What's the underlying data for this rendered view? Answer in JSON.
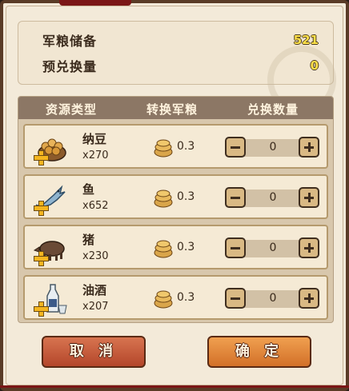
{
  "summary": {
    "grain_reserve_label": "军粮储备",
    "grain_reserve_value": "521",
    "expected_exchange_label": "预兑换量",
    "expected_exchange_value": "0"
  },
  "table": {
    "headers": [
      "资源类型",
      "转换军粮",
      "兑换数量"
    ],
    "rows": [
      {
        "name": "纳豆",
        "count": "x270",
        "rate": "0.3",
        "qty": "0",
        "icon": "natto-icon"
      },
      {
        "name": "鱼",
        "count": "x652",
        "rate": "0.3",
        "qty": "0",
        "icon": "fish-icon"
      },
      {
        "name": "猪",
        "count": "x230",
        "rate": "0.3",
        "qty": "0",
        "icon": "boar-icon"
      },
      {
        "name": "油酒",
        "count": "x207",
        "rate": "0.3",
        "qty": "0",
        "icon": "sake-icon"
      }
    ]
  },
  "buttons": {
    "cancel": "取 消",
    "confirm": "确 定"
  },
  "colors": {
    "panel": "#f3ead9",
    "header": "#8c7765",
    "value_yellow": "#ffe14a",
    "cancel": "#c3553a",
    "confirm": "#e48a3c"
  }
}
